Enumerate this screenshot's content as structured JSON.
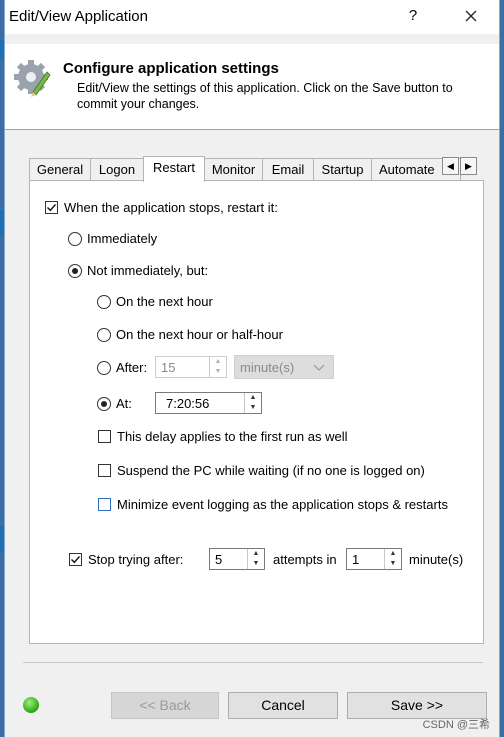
{
  "window": {
    "title": "Edit/View Application",
    "help_glyph": "?",
    "close_glyph": "✕"
  },
  "header": {
    "title": "Configure application settings",
    "description": "Edit/View the settings of this application. Click on the Save button to commit your changes."
  },
  "tabs": [
    "General",
    "Logon",
    "Restart",
    "Monitor",
    "Email",
    "Startup",
    "Automate"
  ],
  "active_tab": "Restart",
  "tab_scroll": {
    "left": "◀",
    "right": "▶"
  },
  "restart": {
    "restart_when_stops": {
      "label": "When the application stops, restart it:",
      "checked": true
    },
    "immediately": {
      "label": "Immediately",
      "selected": false
    },
    "not_immediately": {
      "label": "Not immediately, but:",
      "selected": true
    },
    "next_hour": {
      "label": "On the next hour",
      "selected": false
    },
    "next_half_hour": {
      "label": "On the next hour or half-hour",
      "selected": false
    },
    "after": {
      "label": "After:",
      "selected": false,
      "value": "15",
      "unit": "minute(s)"
    },
    "at": {
      "label": "At:",
      "selected": true,
      "value": "7:20:56"
    },
    "first_run": {
      "label": "This delay applies to the first run as well",
      "checked": false
    },
    "suspend_pc": {
      "label": "Suspend the PC while waiting (if no one is logged on)",
      "checked": false
    },
    "minimize_logging": {
      "label": "Minimize event logging as the application stops & restarts",
      "checked": false
    },
    "stop_trying": {
      "label": "Stop trying after:",
      "checked": true,
      "attempts": "5",
      "attempts_label": "attempts in",
      "minutes": "1",
      "minutes_label": "minute(s)"
    }
  },
  "footer": {
    "back": "<< Back",
    "cancel": "Cancel",
    "save": "Save >>",
    "status_color": "#27a510"
  },
  "watermark": "CSDN @三希"
}
